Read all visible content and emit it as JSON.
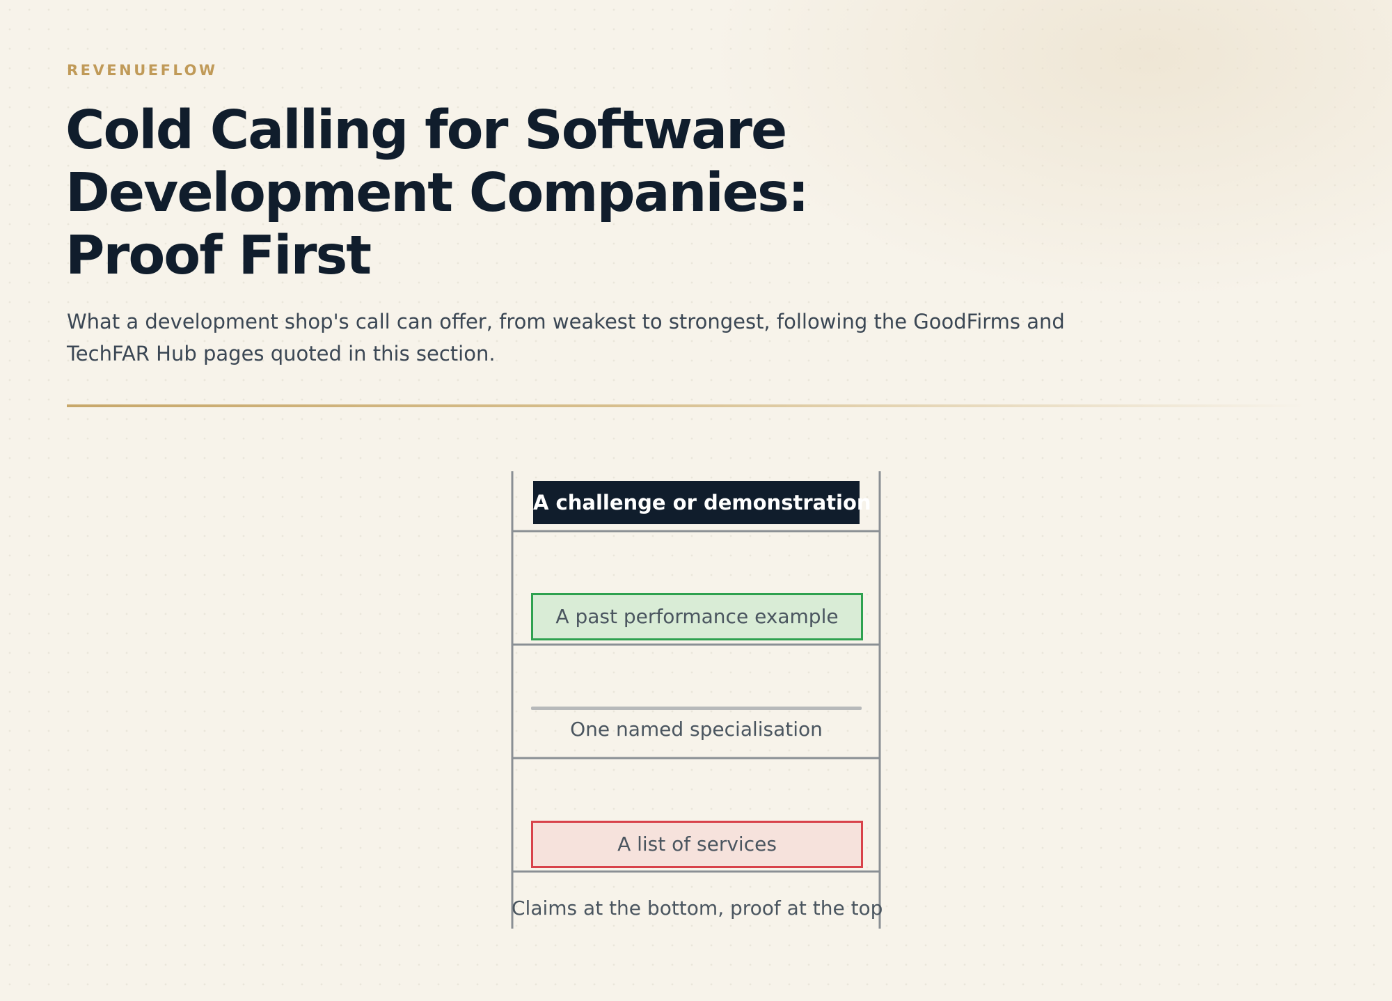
{
  "header": {
    "brand": "REVENUEFLOW",
    "title_lines": [
      "Cold Calling for Software",
      "Development Companies:",
      "Proof First"
    ],
    "subtitle_lines": [
      "What a development shop's call can offer, from weakest to strongest, following the GoodFirms and",
      "TechFAR Hub pages quoted in this section."
    ]
  },
  "diagram": {
    "rungs_top_to_bottom": [
      {
        "label": "A challenge or demonstration",
        "style": "dark"
      },
      {
        "label": "A past performance example",
        "style": "green"
      },
      {
        "label": "One named specialisation",
        "style": "plain"
      },
      {
        "label": "A list of services",
        "style": "red"
      }
    ],
    "caption": "Claims at the bottom, proof at the top"
  },
  "colors": {
    "background": "#f7f3ea",
    "brand": "#c09a58",
    "navy": "#101d2c",
    "green_border": "#2ea14f",
    "green_fill": "#d9ecd6",
    "red_border": "#d8424a",
    "red_fill": "#f6e2dc",
    "ladder_line": "#8a8f94"
  }
}
